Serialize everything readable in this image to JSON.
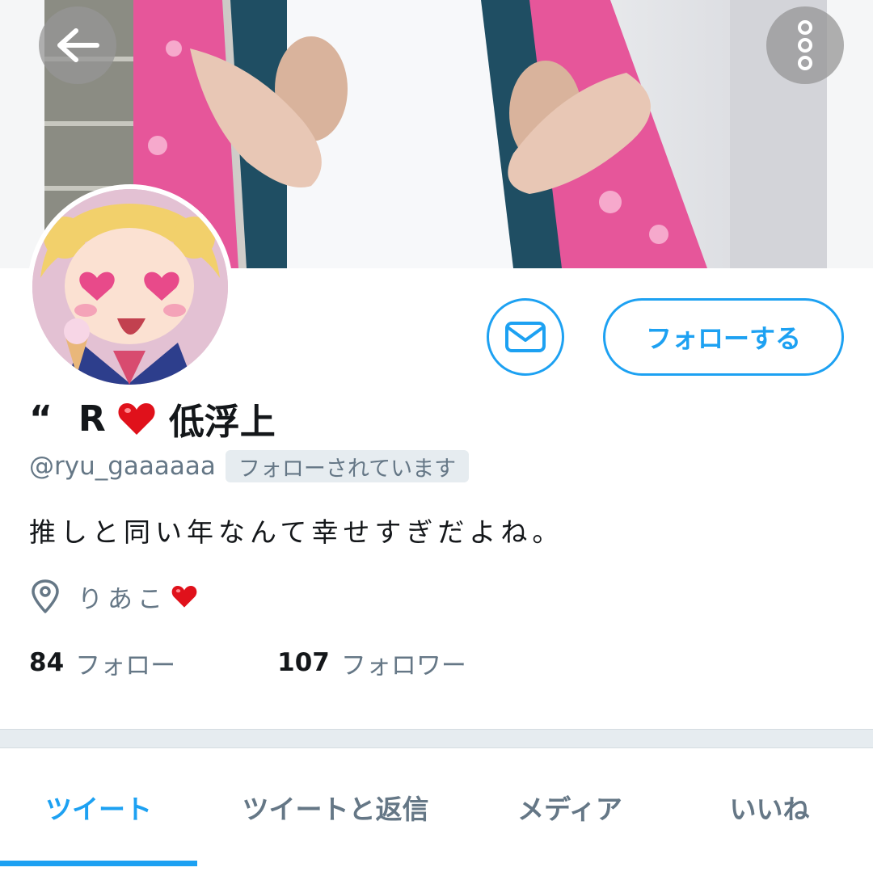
{
  "header": {
    "back_icon": "arrow-left-icon",
    "more_icon": "vertical-dots-icon"
  },
  "profile": {
    "name_quote": "“",
    "name_letter": "R",
    "name_heart_icon": "red-heart-icon",
    "name_suffix": "低浮上",
    "handle": "@ryu_gaaaaaa",
    "follows_you": "フォローされています",
    "bio": "推しと同い年なんて幸せすぎだよね。",
    "location": "りあこ",
    "location_icon": "location-pin-icon",
    "message_icon": "envelope-icon",
    "follow_label": "フォローする"
  },
  "stats": {
    "following_count": "84",
    "following_label": "フォロー",
    "followers_count": "107",
    "followers_label": "フォロワー"
  },
  "tabs": [
    {
      "label": "ツイート",
      "active": true
    },
    {
      "label": "ツイートと返信",
      "active": false
    },
    {
      "label": "メディア",
      "active": false
    },
    {
      "label": "いいね",
      "active": false
    }
  ],
  "colors": {
    "accent": "#1da1f2",
    "text": "#14171a",
    "secondary": "#657786",
    "heart": "#e0111b"
  }
}
